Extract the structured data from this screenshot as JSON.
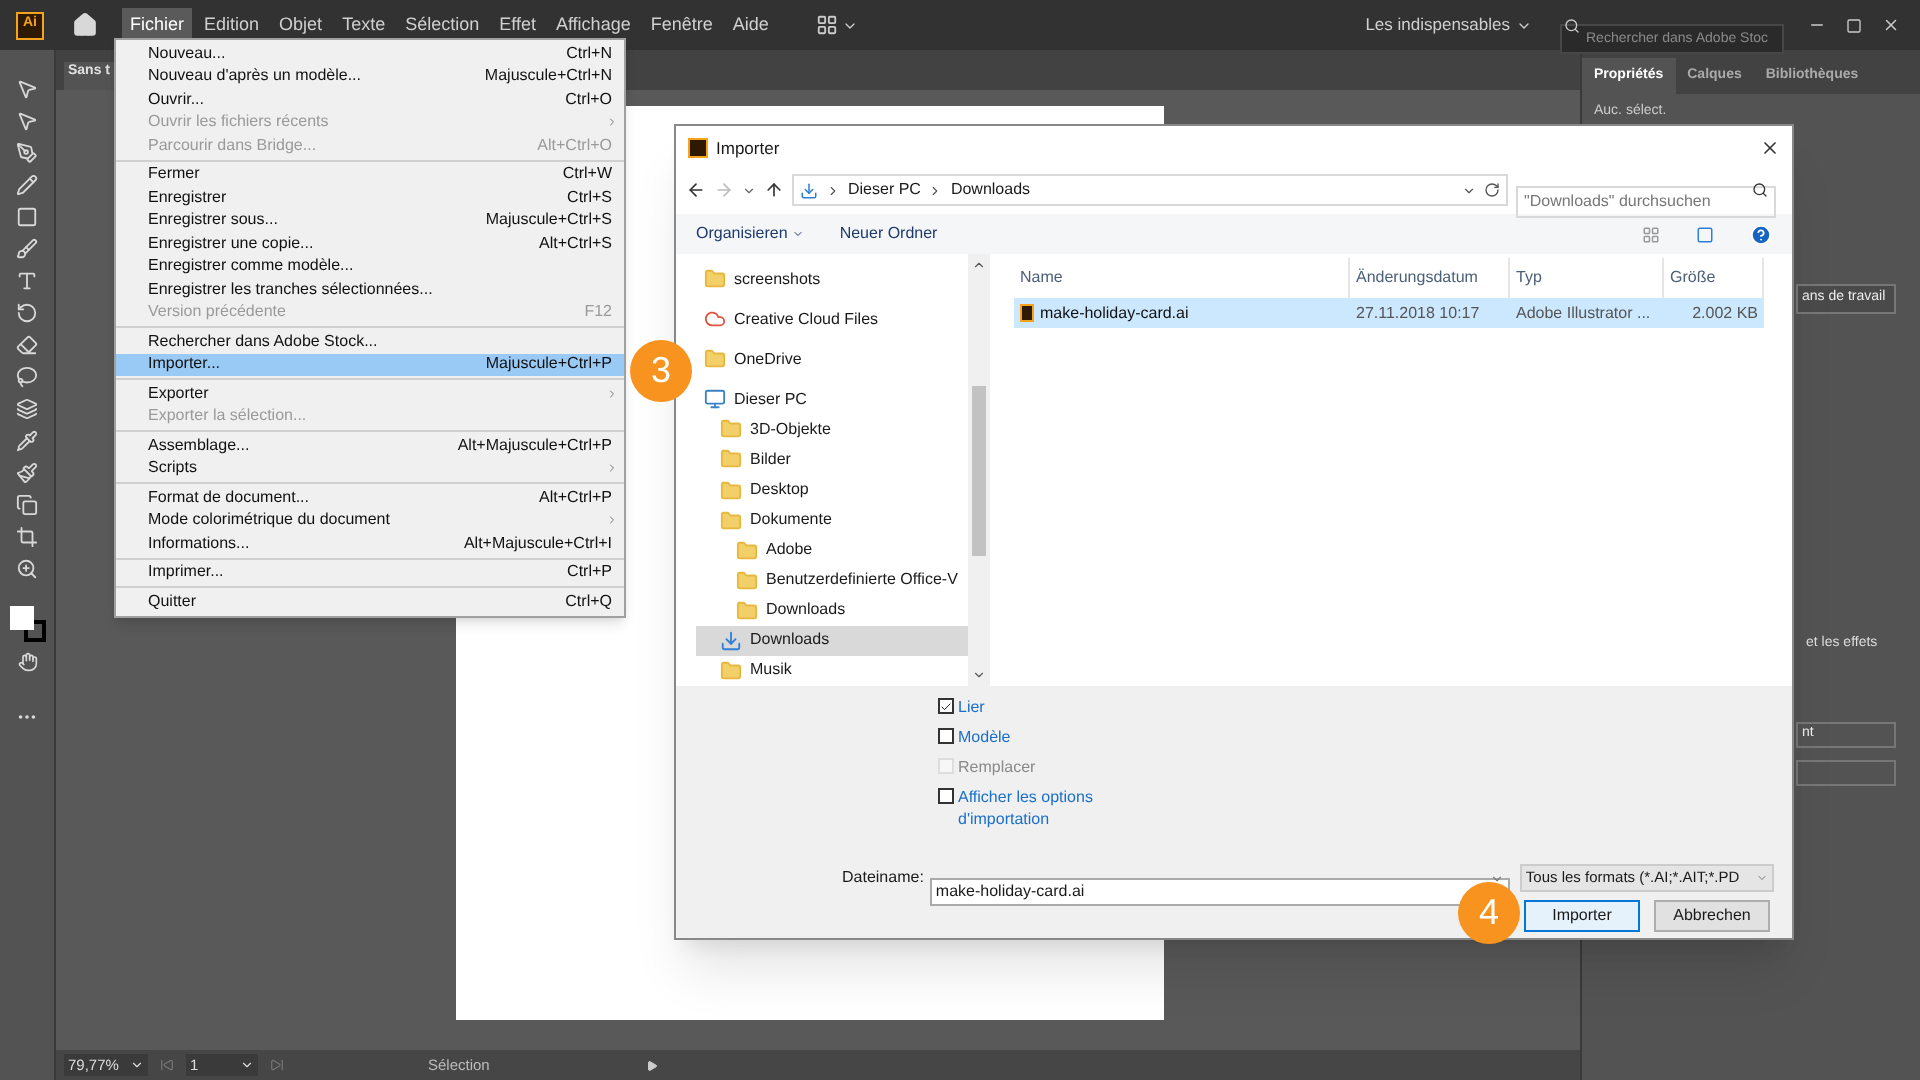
{
  "app_bar": {
    "logo": "Ai",
    "menus": [
      {
        "label": "Fichier",
        "selected": true
      },
      {
        "label": "Edition",
        "selected": false
      },
      {
        "label": "Objet",
        "selected": false
      },
      {
        "label": "Texte",
        "selected": false
      },
      {
        "label": "Sélection",
        "selected": false
      },
      {
        "label": "Effet",
        "selected": false
      },
      {
        "label": "Affichage",
        "selected": false
      },
      {
        "label": "Fenêtre",
        "selected": false
      },
      {
        "label": "Aide",
        "selected": false
      }
    ],
    "workspace": "Les indispensables",
    "search": {
      "placeholder": "Rechercher dans Adobe Stoc"
    }
  },
  "document_tab": "Sans t",
  "file_menu": {
    "sections": [
      [
        {
          "label": "Nouveau...",
          "shortcut": "Ctrl+N",
          "disabled": false,
          "selected": false,
          "submenu": false
        },
        {
          "label": "Nouveau d'après un modèle...",
          "shortcut": "Majuscule+Ctrl+N",
          "disabled": false,
          "selected": false,
          "submenu": false
        },
        {
          "label": "Ouvrir...",
          "shortcut": "Ctrl+O",
          "disabled": false,
          "selected": false,
          "submenu": false
        },
        {
          "label": "Ouvrir les fichiers récents",
          "disabled": true,
          "selected": false,
          "submenu": true
        },
        {
          "label": "Parcourir dans Bridge...",
          "shortcut": "Alt+Ctrl+O",
          "disabled": true,
          "selected": false,
          "submenu": false
        }
      ],
      [
        {
          "label": "Fermer",
          "shortcut": "Ctrl+W",
          "disabled": false,
          "selected": false,
          "submenu": false
        },
        {
          "label": "Enregistrer",
          "shortcut": "Ctrl+S",
          "disabled": false,
          "selected": false,
          "submenu": false
        },
        {
          "label": "Enregistrer sous...",
          "shortcut": "Majuscule+Ctrl+S",
          "disabled": false,
          "selected": false,
          "submenu": false
        },
        {
          "label": "Enregistrer une copie...",
          "shortcut": "Alt+Ctrl+S",
          "disabled": false,
          "selected": false,
          "submenu": false
        },
        {
          "label": "Enregistrer comme modèle...",
          "disabled": false,
          "selected": false,
          "submenu": false
        },
        {
          "label": "Enregistrer les tranches sélectionnées...",
          "disabled": false,
          "selected": false,
          "submenu": false
        },
        {
          "label": "Version précédente",
          "shortcut": "F12",
          "disabled": true,
          "selected": false,
          "submenu": false
        }
      ],
      [
        {
          "label": "Rechercher dans Adobe Stock...",
          "disabled": false,
          "selected": false,
          "submenu": false
        },
        {
          "label": "Importer...",
          "shortcut": "Majuscule+Ctrl+P",
          "disabled": false,
          "selected": true,
          "submenu": false
        }
      ],
      [
        {
          "label": "Exporter",
          "disabled": false,
          "selected": false,
          "submenu": true
        },
        {
          "label": "Exporter la sélection...",
          "disabled": true,
          "selected": false,
          "submenu": false
        }
      ],
      [
        {
          "label": "Assemblage...",
          "shortcut": "Alt+Majuscule+Ctrl+P",
          "disabled": false,
          "selected": false,
          "submenu": false
        },
        {
          "label": "Scripts",
          "disabled": false,
          "selected": false,
          "submenu": true
        }
      ],
      [
        {
          "label": "Format de document...",
          "shortcut": "Alt+Ctrl+P",
          "disabled": false,
          "selected": false,
          "submenu": false
        },
        {
          "label": "Mode colorimétrique du document",
          "disabled": false,
          "selected": false,
          "submenu": true
        },
        {
          "label": "Informations...",
          "shortcut": "Alt+Majuscule+Ctrl+I",
          "disabled": false,
          "selected": false,
          "submenu": false
        }
      ],
      [
        {
          "label": "Imprimer...",
          "shortcut": "Ctrl+P",
          "disabled": false,
          "selected": false,
          "submenu": false
        }
      ],
      [
        {
          "label": "Quitter",
          "shortcut": "Ctrl+Q",
          "disabled": false,
          "selected": false,
          "submenu": false
        }
      ]
    ]
  },
  "right_panel": {
    "tabs": [
      {
        "label": "Propriétés",
        "selected": true
      },
      {
        "label": "Calques",
        "selected": false
      },
      {
        "label": "Bibliothèques",
        "selected": false
      }
    ],
    "status": "Auc. sélect.",
    "button_1": "ans de travail",
    "text_1": "et les effets",
    "button_2": "nt"
  },
  "status_bar": {
    "zoom": "79,77%",
    "page": "1",
    "tool": "Sélection"
  },
  "dialog": {
    "title": "Importer",
    "path": [
      "Dieser PC",
      "Downloads"
    ],
    "search": {
      "placeholder": "\"Downloads\" durchsuchen"
    },
    "toolbar": [
      "Organisieren",
      "Neuer Ordner"
    ],
    "nav": [
      {
        "label": "screenshots",
        "kind": "folder",
        "selected": false
      },
      {
        "label": "Creative Cloud Files",
        "kind": "cloud",
        "selected": false
      },
      {
        "label": "OneDrive",
        "kind": "folder",
        "selected": false
      },
      {
        "label": "Dieser PC",
        "kind": "computer",
        "selected": false,
        "children": [
          {
            "label": "3D-Objekte",
            "kind": "folder",
            "selected": false
          },
          {
            "label": "Bilder",
            "kind": "folder",
            "selected": false
          },
          {
            "label": "Desktop",
            "kind": "folder",
            "selected": false
          },
          {
            "label": "Dokumente",
            "kind": "folder",
            "selected": false,
            "children": [
              {
                "label": "Adobe",
                "kind": "folder",
                "selected": false
              },
              {
                "label": "Benutzerdefinierte Office-V",
                "kind": "folder",
                "selected": false
              },
              {
                "label": "Downloads",
                "kind": "folder",
                "selected": false
              }
            ]
          },
          {
            "label": "Downloads",
            "kind": "download",
            "selected": true
          },
          {
            "label": "Musik",
            "kind": "folder",
            "selected": false
          }
        ]
      }
    ],
    "columns": [
      "Name",
      "Änderungsdatum",
      "Typ",
      "Größe"
    ],
    "rows": [
      {
        "selected": true,
        "cells": [
          "make-holiday-card.ai",
          "27.11.2018 10:17",
          "Adobe Illustrator ...",
          "2.002 KB"
        ]
      }
    ],
    "options": [
      {
        "label": "Lier",
        "checked": true,
        "disabled": false
      },
      {
        "label": "Modèle",
        "checked": false,
        "disabled": false
      },
      {
        "label": "Remplacer",
        "checked": false,
        "disabled": true
      },
      {
        "label": "Afficher les options d'importation",
        "checked": false,
        "disabled": false
      }
    ],
    "filename_label": "Dateiname:",
    "filename": "make-holiday-card.ai",
    "filter": "Tous les formats (*.AI;*.AIT;*.PD",
    "buttons": [
      {
        "label": "Importer",
        "kind": "primary"
      },
      {
        "label": "Abbrechen",
        "kind": "secondary"
      }
    ]
  },
  "step_badges": [
    "3",
    "4"
  ]
}
